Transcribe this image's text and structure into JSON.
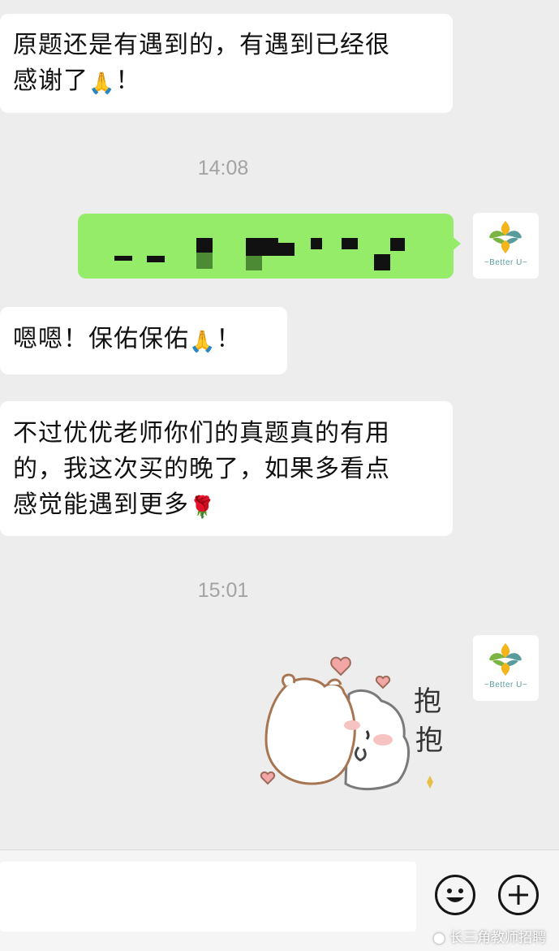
{
  "messages": {
    "m1": {
      "line1": "原题还是有遇到的，有遇到已经很",
      "line2": "感谢了",
      "emoji": "🙏",
      "end": "！"
    },
    "time1": "14:08",
    "m3": {
      "text": "嗯嗯！保佑保佑",
      "emoji": "🙏",
      "end": "！"
    },
    "m4": {
      "line1": "不过优优老师你们的真题真的有用",
      "line2": "的，我这次买的晚了，如果多看点",
      "line3": "感觉能遇到更多",
      "emoji": "🌹"
    },
    "time2": "15:01"
  },
  "avatar": {
    "label": "~Better U~"
  },
  "sticker": {
    "text1": "抱",
    "text2": "抱"
  },
  "footer": {
    "watermark": "长三角教师招聘"
  },
  "colors": {
    "background": "#ededed",
    "sent_bubble": "#95ec69",
    "received_bubble": "#ffffff",
    "timestamp": "#a3a3a3"
  },
  "icons": {
    "emoji_button": "smiley-face-icon",
    "more_button": "plus-icon",
    "watermark": "wechat-icon"
  }
}
